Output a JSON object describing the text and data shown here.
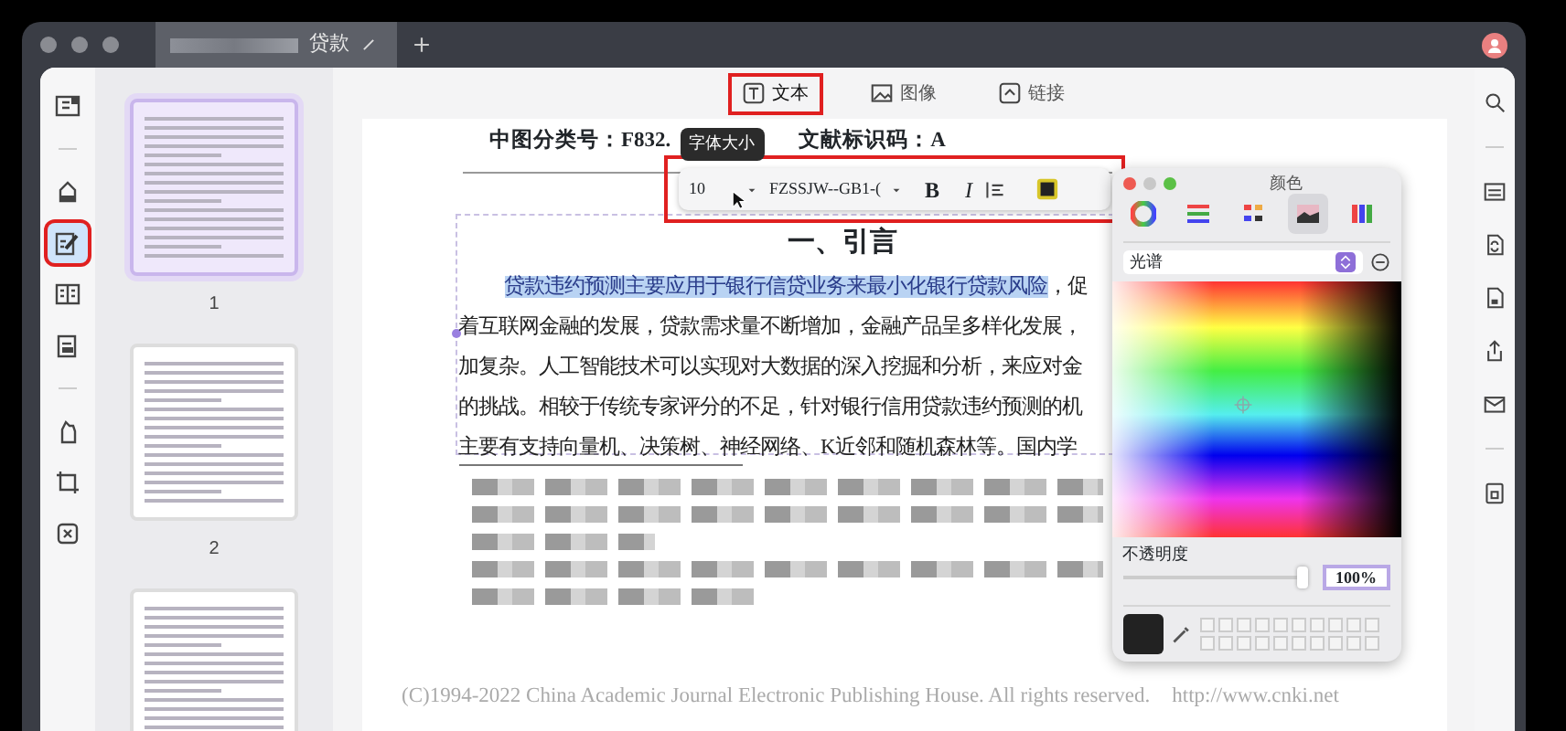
{
  "window": {
    "tab_title": "贷款"
  },
  "left_rail": [
    {
      "kind": "view",
      "selected": false,
      "red_outline": false
    },
    {
      "kind": "highlight",
      "selected": false,
      "red_outline": false
    },
    {
      "kind": "edit",
      "selected": true,
      "red_outline": true
    },
    {
      "kind": "pages",
      "selected": false,
      "red_outline": false
    },
    {
      "kind": "form",
      "selected": false,
      "red_outline": false
    },
    {
      "kind": "protect",
      "selected": false,
      "red_outline": false
    },
    {
      "kind": "crop",
      "selected": false,
      "red_outline": false
    },
    {
      "kind": "ocr",
      "selected": false,
      "red_outline": false
    }
  ],
  "thumbnails": [
    {
      "label": "1",
      "selected": true
    },
    {
      "label": "2",
      "selected": false
    },
    {
      "selected": false
    }
  ],
  "edit_toolbar": [
    {
      "label": "文本",
      "selected": true,
      "red_outline": true
    },
    {
      "label": "图像",
      "selected": false,
      "red_outline": false
    },
    {
      "label": "链接",
      "selected": false,
      "red_outline": false
    }
  ],
  "document": {
    "classification": "中图分类号：F832.",
    "doc_code": "文献标识码：A",
    "heading": "一、引言",
    "lines": [
      {
        "highlighted": "贷款违约预测主要应用于银行信贷业务来最小化银行贷款风险",
        "text": "，促"
      },
      {
        "text": "着互联网金融的发展，贷款需求量不断增加，金融产品呈多样化发展，"
      },
      {
        "text": "加复杂。人工智能技术可以实现对大数据的深入挖掘和分析，来应对金"
      },
      {
        "text": "的挑战。相较于传统专家评分的不足，针对银行信用贷款违约预测的机"
      },
      {
        "text": "主要有支持向量机、决策树、神经网络、K近邻和随机森林等。国内学"
      }
    ],
    "footer": "(C)1994-2022 China Academic Journal Electronic Publishing House. All rights reserved.",
    "footer_url": "http://www.cnki.net"
  },
  "format_toolbar": {
    "tooltip": "字体大小",
    "font_size": "10",
    "font_name": "FZSSJW--GB1-(",
    "bold": "B",
    "italic": "I",
    "red_outline": true
  },
  "color_panel": {
    "title": "颜色",
    "modes": [
      {
        "kind": "wheel",
        "selected": false
      },
      {
        "kind": "sliders",
        "selected": false
      },
      {
        "kind": "palettes",
        "selected": false
      },
      {
        "kind": "spectrum",
        "selected": true
      },
      {
        "kind": "pencils",
        "selected": false
      }
    ],
    "palette": "光谱",
    "opacity_label": "不透明度",
    "opacity": {
      "level": 1,
      "reading": "100%"
    }
  },
  "right_rail": [
    {
      "kind": "search"
    },
    {
      "kind": "ocr"
    },
    {
      "kind": "convert"
    },
    {
      "kind": "protect"
    },
    {
      "kind": "share"
    },
    {
      "kind": "mail"
    },
    {
      "kind": "save"
    }
  ]
}
